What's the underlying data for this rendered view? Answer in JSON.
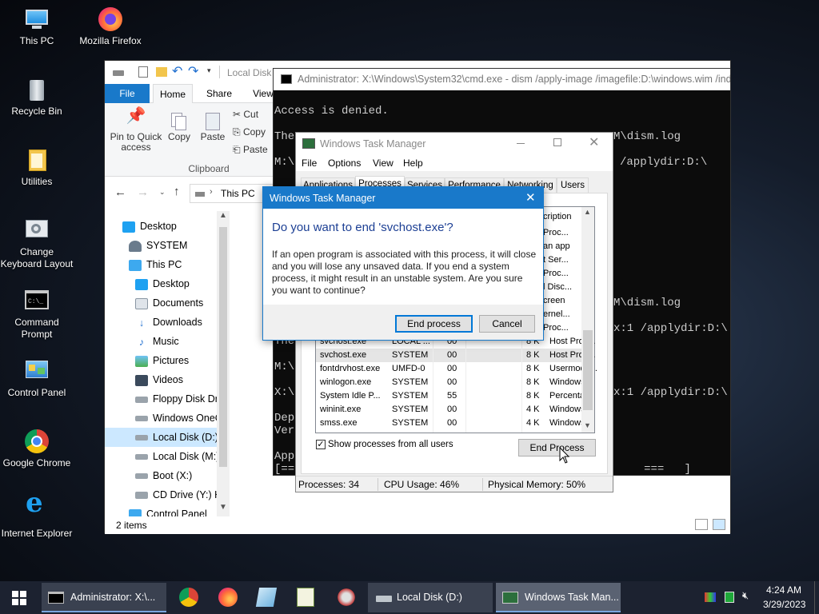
{
  "desktop": {
    "icons": [
      {
        "label": "This PC"
      },
      {
        "label": "Mozilla Firefox"
      },
      {
        "label": "Recycle Bin"
      },
      {
        "label": "Utilities"
      },
      {
        "label": "Change Keyboard Layout"
      },
      {
        "label": "Command Prompt"
      },
      {
        "label": "Control Panel"
      },
      {
        "label": "Google Chrome"
      },
      {
        "label": "Internet Explorer"
      }
    ]
  },
  "explorer": {
    "title": "Local Disk",
    "tabs": {
      "file": "File",
      "home": "Home",
      "share": "Share",
      "view": "View"
    },
    "ribbon": {
      "pin": "Pin to Quick",
      "pin2": "access",
      "copy": "Copy",
      "paste": "Paste",
      "cut": "Cut",
      "copy_path": "Copy",
      "paste_shortcut": "Paste",
      "group": "Clipboard"
    },
    "address": {
      "segment": "This PC"
    },
    "tree": [
      {
        "label": "Desktop"
      },
      {
        "label": "SYSTEM"
      },
      {
        "label": "This PC"
      },
      {
        "label": "Desktop"
      },
      {
        "label": "Documents"
      },
      {
        "label": "Downloads"
      },
      {
        "label": "Music"
      },
      {
        "label": "Pictures"
      },
      {
        "label": "Videos"
      },
      {
        "label": "Floppy Disk Dri"
      },
      {
        "label": "Windows OneC"
      },
      {
        "label": "Local Disk (D:)"
      },
      {
        "label": "Local Disk (M:)"
      },
      {
        "label": "Boot (X:)"
      },
      {
        "label": "CD Drive (Y:) H"
      },
      {
        "label": "Control Panel"
      }
    ],
    "status": "2 items"
  },
  "cmd": {
    "title": "Administrator: X:\\Windows\\System32\\cmd.exe - dism  /apply-image /imagefile:D:\\windows.wim /index:1 /applydir:D:\\",
    "lines": [
      {
        "t": "Access is denied."
      },
      {
        "t": "The"
      },
      {
        "t": "M:\\>"
      },
      {
        "t": "M\\dism.log"
      },
      {
        "t": "/applydir:D:\\"
      },
      {
        "t": "M\\dism.log"
      },
      {
        "t": "x:1 /applydir:D:\\"
      },
      {
        "t": "The"
      },
      {
        "t": "M:\\>"
      },
      {
        "t": "X:\\>"
      },
      {
        "t": "x:1 /applydir:D:\\"
      },
      {
        "t": "Depl"
      },
      {
        "t": "Vers"
      },
      {
        "t": "Appl"
      },
      {
        "t": "[===                                                   ===   ]"
      }
    ]
  },
  "taskmgr": {
    "title": "Windows Task Manager",
    "menu": {
      "file": "File",
      "options": "Options",
      "view": "View",
      "help": "Help"
    },
    "tabs": {
      "applications": "Applications",
      "processes": "Processes",
      "services": "Services",
      "performance": "Performance",
      "networking": "Networking",
      "users": "Users"
    },
    "desc_header": "cription",
    "desc_partial": [
      "Proc...",
      "an app",
      "t Ser...",
      "Proc...",
      "l Disc...",
      "creen",
      "ernel...",
      "Proc..."
    ],
    "processes": [
      {
        "name": "svchost.exe",
        "user": "LOCAL ...",
        "cpu": "00",
        "mem": "8 K",
        "desc": "Host Proc..."
      },
      {
        "name": "svchost.exe",
        "user": "SYSTEM",
        "cpu": "00",
        "mem": "8 K",
        "desc": "Host Proc..."
      },
      {
        "name": "fontdrvhost.exe",
        "user": "UMFD-0",
        "cpu": "00",
        "mem": "8 K",
        "desc": "Usermode..."
      },
      {
        "name": "winlogon.exe",
        "user": "SYSTEM",
        "cpu": "00",
        "mem": "8 K",
        "desc": "Windows ..."
      },
      {
        "name": "System Idle P...",
        "user": "SYSTEM",
        "cpu": "55",
        "mem": "8 K",
        "desc": "Percenta..."
      },
      {
        "name": "wininit.exe",
        "user": "SYSTEM",
        "cpu": "00",
        "mem": "4 K",
        "desc": "Windows ..."
      },
      {
        "name": "smss.exe",
        "user": "SYSTEM",
        "cpu": "00",
        "mem": "4 K",
        "desc": "Windows ..."
      }
    ],
    "show_all": "Show processes from all users",
    "end_process": "End Process",
    "status": {
      "processes": "Processes: 34",
      "cpu": "CPU Usage: 46%",
      "memory": "Physical Memory: 50%"
    }
  },
  "dialog": {
    "title": "Windows Task Manager",
    "question": "Do you want to end 'svchost.exe'?",
    "body_lines": [
      "If an open program is associated with this process, it will close",
      "and you will lose any unsaved data. If you end a system",
      "process, it might result in an unstable system. Are you sure",
      "you want to continue?"
    ],
    "end_button": "End process",
    "cancel_button": "Cancel"
  },
  "taskbar": {
    "tasks": {
      "cmd": "Administrator: X:\\...",
      "disk": "Local Disk (D:)",
      "taskmgr": "Windows Task Man..."
    },
    "time": "4:24 AM",
    "date": "3/29/2023"
  },
  "colors": {
    "accent": "#0078d7",
    "dialog_title": "#1979ca",
    "selection": "#cce8ff"
  }
}
